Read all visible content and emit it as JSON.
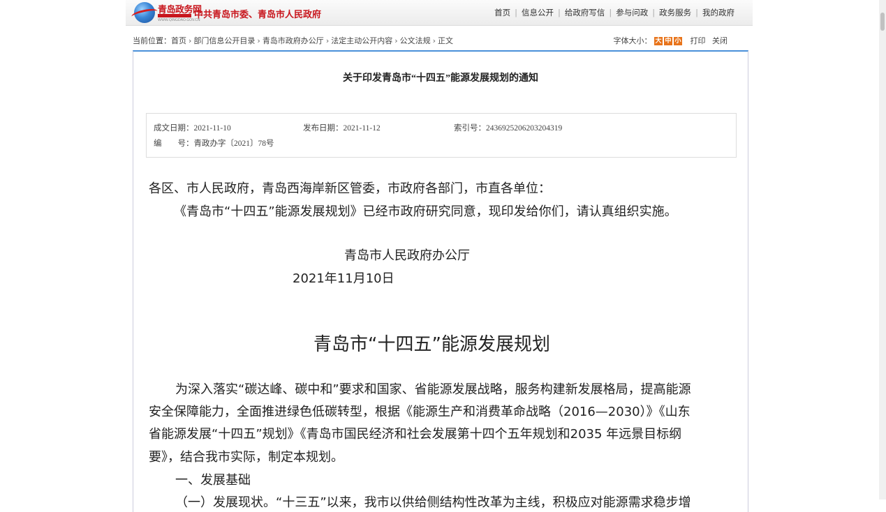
{
  "header": {
    "logo_text": "青岛政务网",
    "logo_url": "WWW.QINGDAO.GOV.CN",
    "site_name": "中共青岛市委、青岛市人民政府",
    "nav": [
      "首页",
      "信息公开",
      "给政府写信",
      "参与问政",
      "政务服务",
      "我的政府"
    ]
  },
  "breadcrumb": {
    "prefix": "当前位置：",
    "items": [
      "首页",
      "部门信息公开目录",
      "青岛市政府办公厅",
      "法定主动公开内容",
      "公文法规",
      "正文"
    ]
  },
  "font_size": {
    "label": "字体大小：",
    "big": "大",
    "mid": "中",
    "small": "小",
    "print": "打印",
    "close": "关闭"
  },
  "document": {
    "title": "关于印发青岛市“十四五”能源发展规划的通知",
    "meta": {
      "date_written": "成文日期：2021-11-10",
      "date_published": "发布日期：2021-11-12",
      "index_no": "索引号：2436925206203204319",
      "doc_no": "编　　号：青政办字〔2021〕78号"
    },
    "addressee": "各区、市人民政府，青岛西海岸新区管委，市政府各部门，市直各单位：",
    "notice": "《青岛市“十四五”能源发展规划》已经市政府研究同意，现印发给你们，请认真组织实施。",
    "issuer": "青岛市人民政府办公厅",
    "issue_date": "2021年11月10日",
    "plan_title": "青岛市“十四五”能源发展规划",
    "para1": [
      "为深入落实“碳达峰、碳中和”要求和国家、省能源发展战略，服务构建新发展格局，提高能源",
      "安全保障能力，全面推进绿色低碳转型，根据《能源生产和消费革命战略（2016—2030）》《山东",
      "省能源发展“十四五”规划》《青岛市国民经济和社会发展第十四个五年规划和2035 年远景目标纲",
      "要》，结合我市实际，制定本规划。"
    ],
    "section1": "一、发展基础",
    "partial_line": "（一）发展现状。“十三五”以来，我市以供给侧结构性改革为主线，积极应对能源需求稳步增"
  }
}
